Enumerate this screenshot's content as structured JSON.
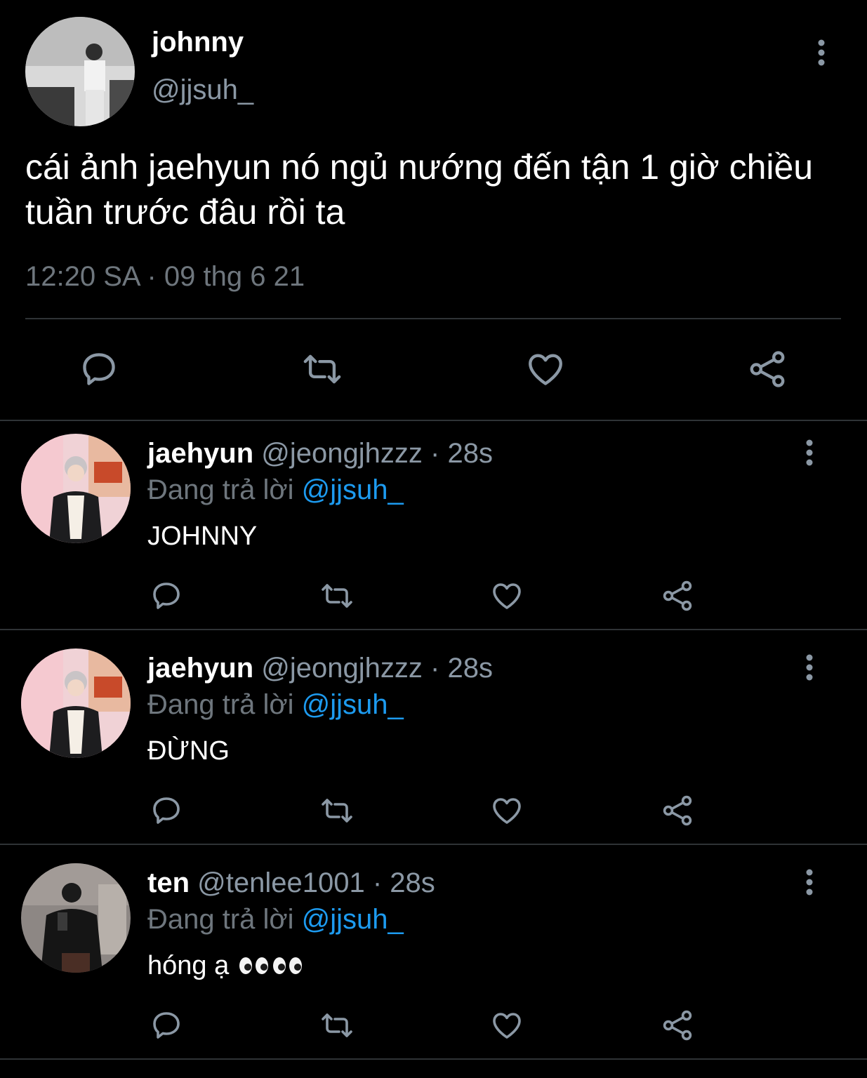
{
  "main_tweet": {
    "name": "johnny",
    "handle": "@jjsuh_",
    "text": "cái ảnh jaehyun nó ngủ nướng đến tận 1 giờ chiều tuần trước đâu rồi ta",
    "timestamp": "12:20 SA · 09 thg 6 21",
    "avatar_icon": "profile-photo"
  },
  "replies": [
    {
      "name": "jaehyun",
      "handle": "@jeongjhzzz",
      "separator": "·",
      "time": "28s",
      "replying_label": "Đang trả lời",
      "mention": "@jjsuh_",
      "text": "JOHNNY"
    },
    {
      "name": "jaehyun",
      "handle": "@jeongjhzzz",
      "separator": "·",
      "time": "28s",
      "replying_label": "Đang trả lời",
      "mention": "@jjsuh_",
      "text": "ĐỪNG"
    },
    {
      "name": "ten",
      "handle": "@tenlee1001",
      "separator": "·",
      "time": "28s",
      "replying_label": "Đang trả lời",
      "mention": "@jjsuh_",
      "text": "hóng ạ",
      "emoji": "👀👀"
    }
  ],
  "actions": [
    "reply-icon",
    "retweet-icon",
    "like-icon",
    "share-icon"
  ],
  "colors": {
    "background": "#000000",
    "text": "#ffffff",
    "secondary": "#8b98a5",
    "mention": "#1d9bf0",
    "divider": "#2f3336",
    "icon": "#8b98a5"
  }
}
